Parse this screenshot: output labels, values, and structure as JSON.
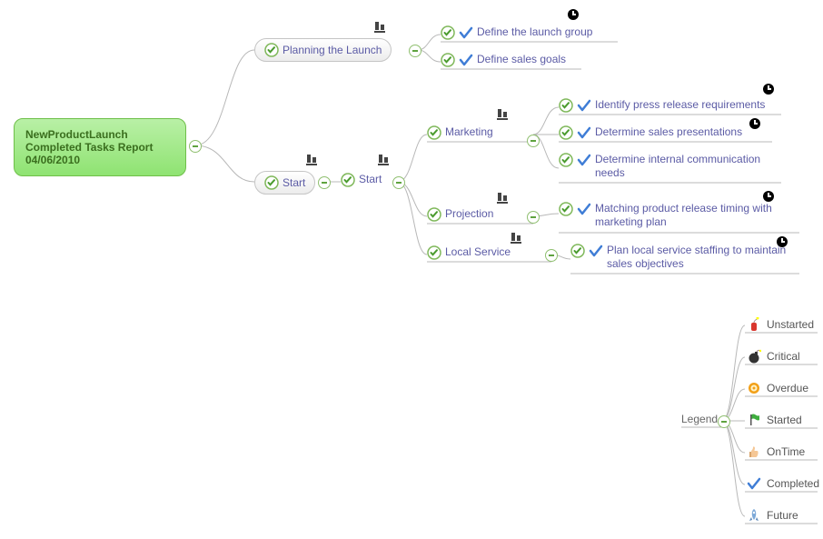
{
  "root": {
    "line1": "NewProductLaunch",
    "line2": "Completed Tasks Report",
    "line3": "04/06/2010"
  },
  "planning": {
    "label": "Planning the Launch"
  },
  "planning_children": {
    "c1": "Define the launch group",
    "c2": "Define sales goals"
  },
  "start1": {
    "label": "Start"
  },
  "start2": {
    "label": "Start"
  },
  "marketing": {
    "label": "Marketing"
  },
  "marketing_children": {
    "c1": "Identify press release requirements",
    "c2": "Determine sales presentations",
    "c3": "Determine internal communication needs"
  },
  "projection": {
    "label": "Projection"
  },
  "projection_children": {
    "c1": "Matching product release timing with marketing plan"
  },
  "local_service": {
    "label": "Local Service"
  },
  "local_service_children": {
    "c1": "Plan local service staffing to maintain sales objectives"
  },
  "legend": {
    "label": "Legend",
    "items": {
      "unstarted": "Unstarted",
      "critical": "Critical",
      "overdue": "Overdue",
      "started": "Started",
      "ontime": "OnTime",
      "completed": "Completed",
      "future": "Future"
    }
  }
}
